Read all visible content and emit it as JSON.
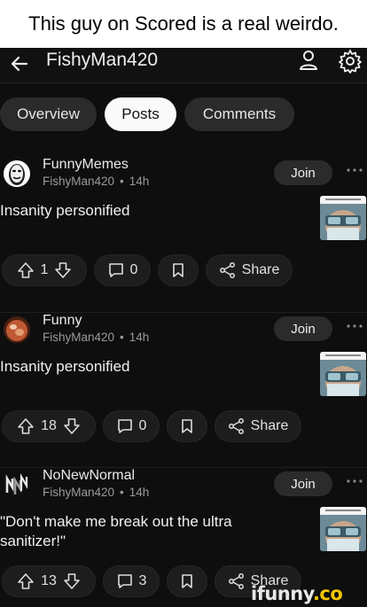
{
  "caption": "This guy on Scored is a real weirdo.",
  "appbar": {
    "title": "FishyMan420"
  },
  "tabs": [
    {
      "label": "Overview"
    },
    {
      "label": "Posts"
    },
    {
      "label": "Comments"
    }
  ],
  "posts": [
    {
      "community": "FunnyMemes",
      "author": "FishyMan420",
      "time": "14h",
      "title": "Insanity personified",
      "join_label": "Join",
      "upvotes": "1",
      "comments": "0",
      "share_label": "Share"
    },
    {
      "community": "Funny",
      "author": "FishyMan420",
      "time": "14h",
      "title": "Insanity personified",
      "join_label": "Join",
      "upvotes": "18",
      "comments": "0",
      "share_label": "Share"
    },
    {
      "community": "NoNewNormal",
      "author": "FishyMan420",
      "time": "14h",
      "title": "\"Don't make me break out the ultra sanitizer!\"",
      "join_label": "Join",
      "upvotes": "13",
      "comments": "3",
      "share_label": "Share"
    }
  ],
  "watermark": {
    "main": "ifunny",
    "suffix": ".co"
  },
  "colors": {
    "background": "#0e0e0e",
    "pill": "#2b2b2b",
    "active_tab": "#fafafa",
    "watermark_accent": "#f3c600"
  },
  "icons": [
    "back-arrow-icon",
    "user-icon",
    "gear-icon",
    "more-icon",
    "upvote-icon",
    "downvote-icon",
    "comment-icon",
    "bookmark-icon",
    "share-icon"
  ]
}
